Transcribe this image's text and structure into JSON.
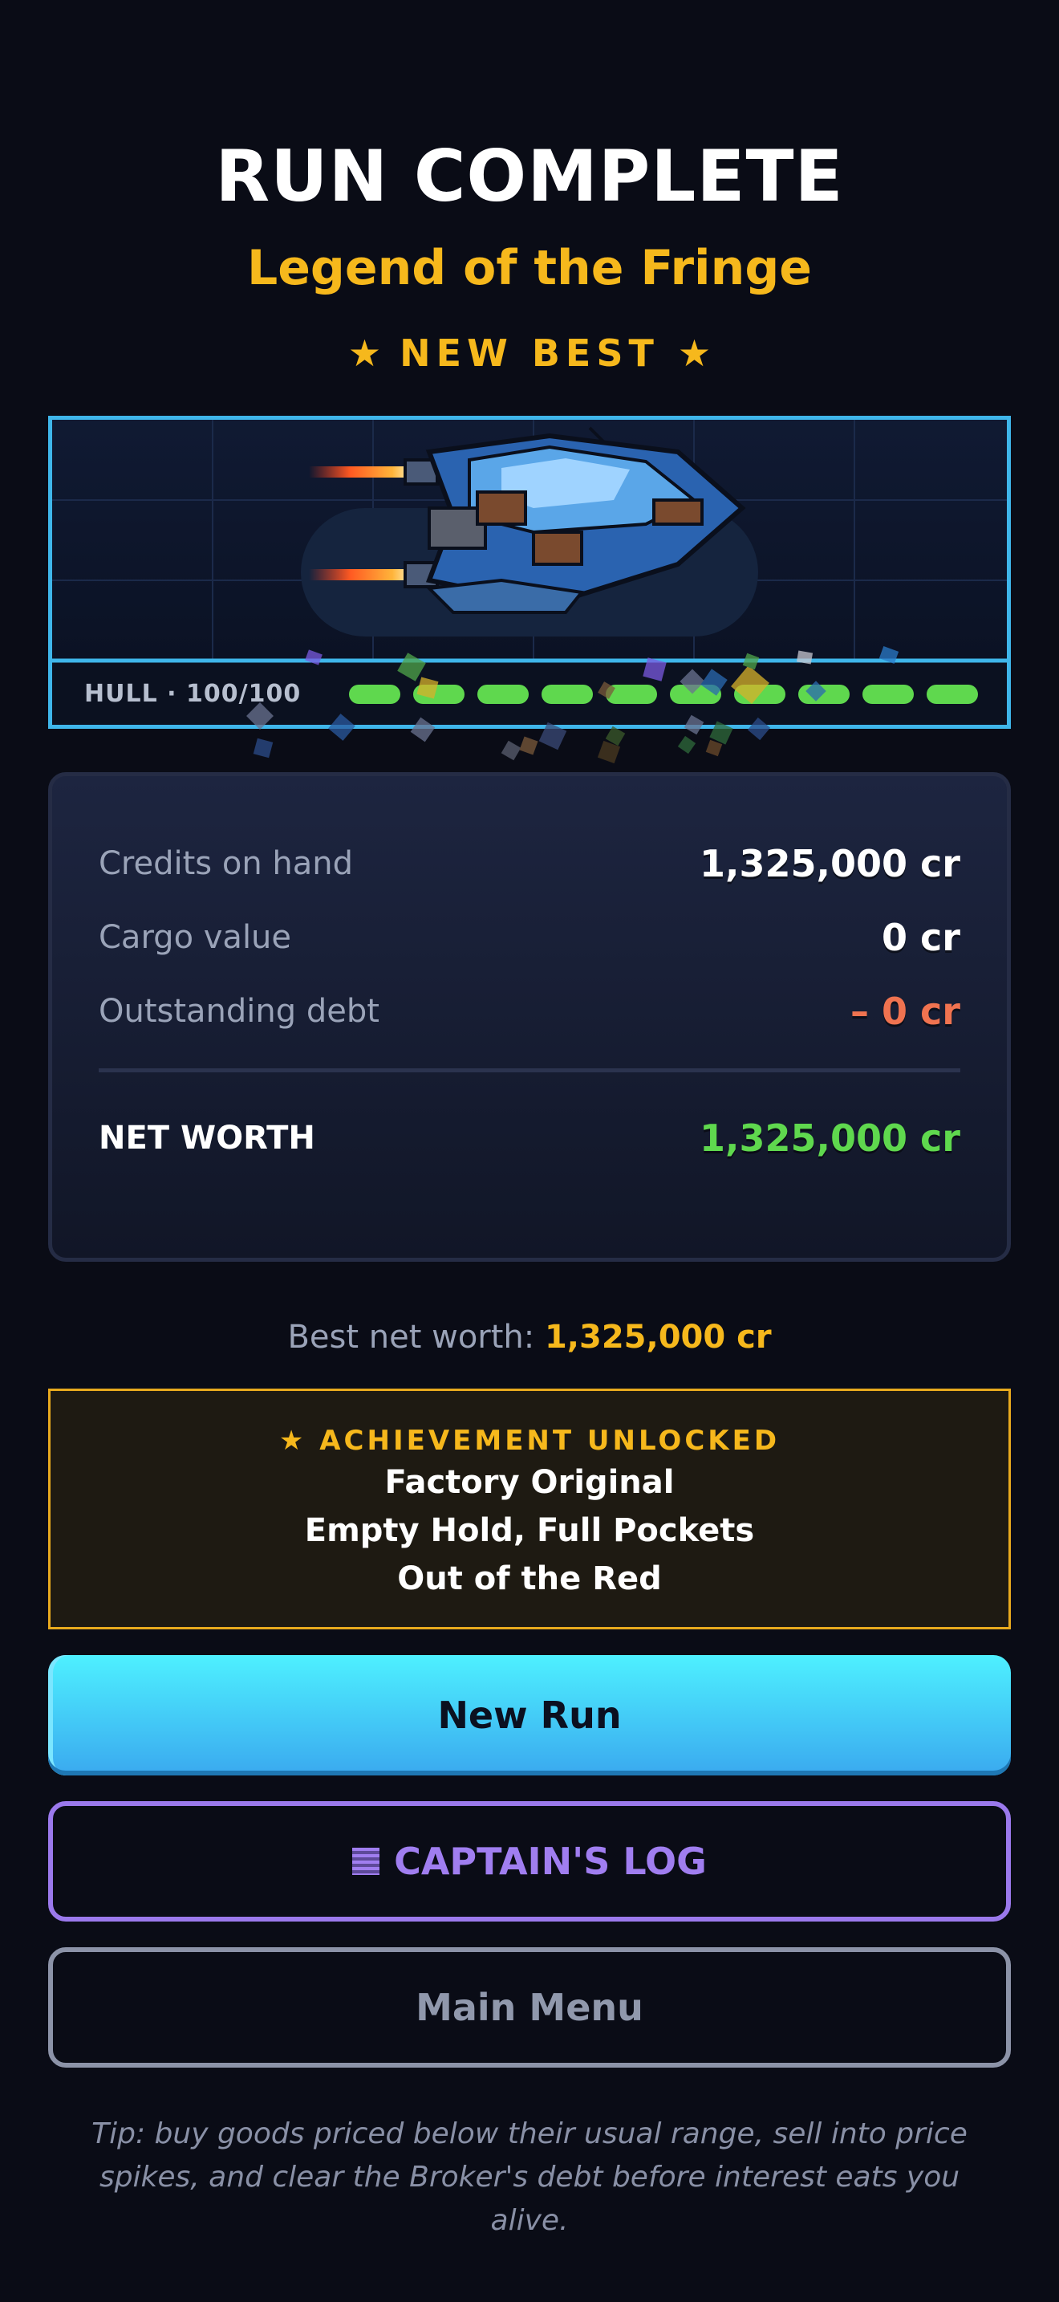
{
  "header": {
    "title": "RUN COMPLETE",
    "rank": "Legend of the Fringe",
    "badge_text": "NEW BEST",
    "badge_icon": "star-icon"
  },
  "ship_panel": {
    "hull_label": "HULL · 100/100",
    "hull_current": 100,
    "hull_max": 100,
    "hull_segments_filled": 10,
    "hull_segments_total": 10,
    "ship_icon": "pixel-spaceship",
    "colors": {
      "frame": "#3fb6ea",
      "hull_bar": "#5fd84e"
    }
  },
  "stats": {
    "rows": [
      {
        "label": "Credits on hand",
        "value": "1,325,000 cr"
      },
      {
        "label": "Cargo value",
        "value": "0 cr"
      },
      {
        "label": "Outstanding debt",
        "value": "– 0 cr"
      }
    ],
    "total_label": "NET WORTH",
    "total_value": "1,325,000 cr",
    "colors": {
      "debt": "#f07350",
      "net_worth": "#5fd84e"
    }
  },
  "best": {
    "label": "Best net worth:",
    "value": "1,325,000 cr"
  },
  "achievements": {
    "heading": "ACHIEVEMENT UNLOCKED",
    "heading_icon": "star-icon",
    "items": [
      "Factory Original",
      "Empty Hold, Full Pockets",
      "Out of the Red"
    ]
  },
  "buttons": {
    "new_run": "New Run",
    "captains_log": "CAPTAIN'S LOG",
    "captains_log_icon": "log-icon",
    "main_menu": "Main Menu"
  },
  "tip": "Tip: buy goods priced below their usual range, sell into price spikes, and clear the Broker's debt before interest eats you alive.",
  "colors": {
    "background": "#0a0c16",
    "accent_gold": "#f6b81c",
    "accent_cyan": "#4ef0ff",
    "accent_purple": "#9b79ec"
  }
}
